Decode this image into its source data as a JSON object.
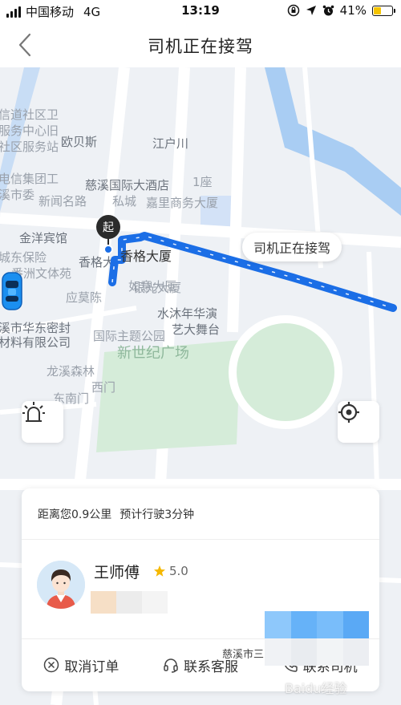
{
  "status_bar": {
    "carrier": "中国移动",
    "network": "4G",
    "time": "13:19",
    "battery_percent": "41%",
    "battery_level": 0.41,
    "battery_color": "#f5c400"
  },
  "nav": {
    "back_icon": "chevron-left-icon",
    "title": "司机正在接驾"
  },
  "map": {
    "labels": {
      "l1": "信道社区卫",
      "l2": "服务中心旧",
      "l3": "社区服务站",
      "l4": "欧贝斯",
      "l5": "江户川",
      "l6": "电信集团工",
      "l7": "溪市委",
      "l8": "新闻名路",
      "l9": "慈溪国际大酒店",
      "l10": "1座",
      "l11": "嘉里商务大厦",
      "l12": "私城",
      "l13": "金洋宾馆",
      "l14": "城东保险",
      "l15": "番洲文体苑",
      "l16": "香格大",
      "l17": "如意大厦",
      "l18": "应莫陈",
      "l19": "银光大厦",
      "l20": "水沐年华演",
      "l21": "艺大舞台",
      "l22": "溪市华东密封",
      "l23": "材料有限公司",
      "l24": "国际主题公园",
      "l25": "新世纪广场",
      "l26": "龙溪森林",
      "l27": "西门",
      "l28": "东南门"
    },
    "start_marker_label": "起",
    "start_place_name": "香格大厦",
    "driver_bubble": "司机正在接驾",
    "car_icon": "car-icon",
    "route_color": "#1b6ee6",
    "sos_icon": "alarm-light-icon",
    "locate_icon": "crosshair-icon"
  },
  "card": {
    "distance_text": "距离您0.9公里",
    "eta_text": "预计行驶3分钟",
    "driver_name": "王师傅",
    "rating": "5.0",
    "plate_city": "慈溪市三",
    "actions": [
      {
        "label": "取消订单",
        "icon": "cancel-circle-icon"
      },
      {
        "label": "联系客服",
        "icon": "headset-icon"
      },
      {
        "label": "联系司机",
        "icon": "phone-icon"
      }
    ]
  },
  "watermark": "Baidu经验"
}
